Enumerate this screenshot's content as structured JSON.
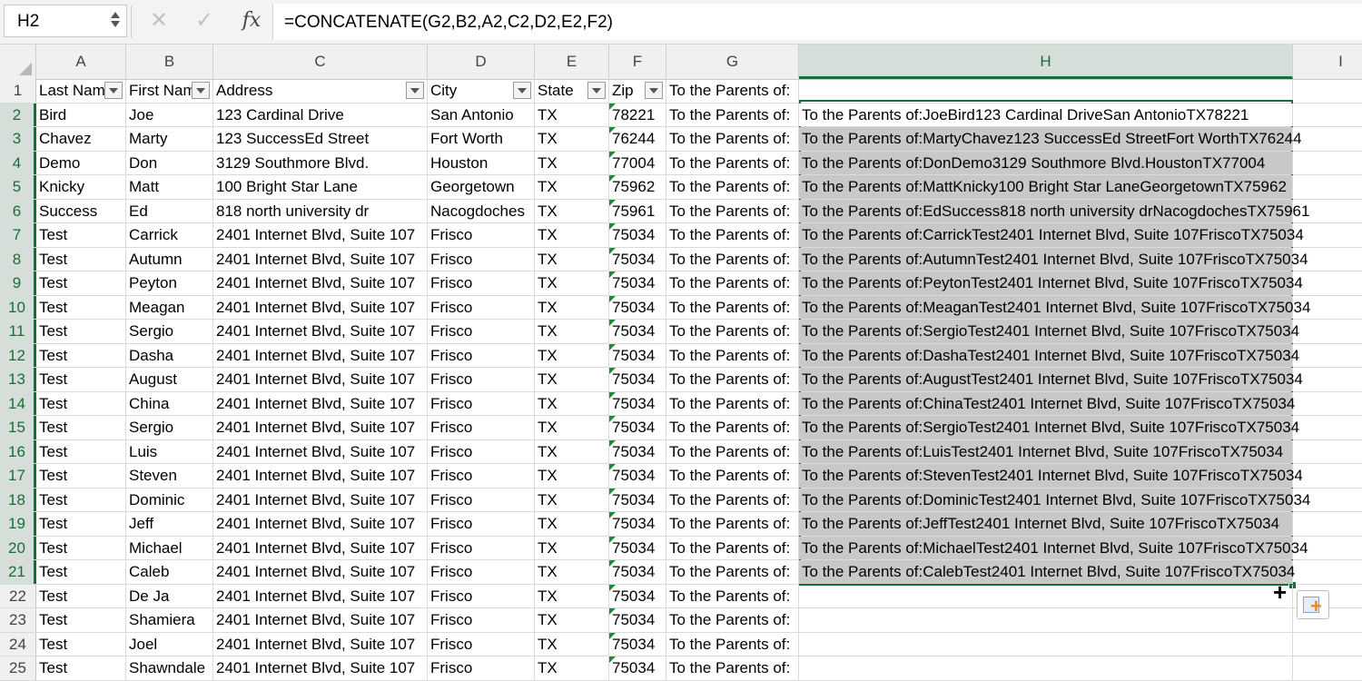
{
  "formula_bar": {
    "name_box": "H2",
    "cancel_icon": "✕",
    "enter_icon": "✓",
    "fx_label": "fx",
    "formula": "=CONCATENATE(G2,B2,A2,C2,D2,E2,F2)"
  },
  "columns": [
    "A",
    "B",
    "C",
    "D",
    "E",
    "F",
    "G",
    "H",
    "I"
  ],
  "header_row": {
    "A": "Last Nam",
    "B": "First Nam",
    "C": "Address",
    "D": "City",
    "E": "State",
    "F": "Zip",
    "G": "To the Parents of:",
    "H": ""
  },
  "rows": [
    {
      "n": "2",
      "A": "Bird",
      "B": "Joe",
      "C": "123 Cardinal Drive",
      "D": "San Antonio",
      "E": "TX",
      "F": "78221",
      "G": "To the Parents of:",
      "H": "To the Parents of:JoeBird123 Cardinal DriveSan AntonioTX78221"
    },
    {
      "n": "3",
      "A": "Chavez",
      "B": "Marty",
      "C": "123 SuccessEd Street",
      "D": "Fort Worth",
      "E": "TX",
      "F": "76244",
      "G": "To the Parents of:",
      "H": "To the Parents of:MartyChavez123 SuccessEd StreetFort WorthTX76244"
    },
    {
      "n": "4",
      "A": "Demo",
      "B": "Don",
      "C": "3129 Southmore Blvd.",
      "D": "Houston",
      "E": "TX",
      "F": "77004",
      "G": "To the Parents of:",
      "H": "To the Parents of:DonDemo3129 Southmore Blvd.HoustonTX77004"
    },
    {
      "n": "5",
      "A": "Knicky",
      "B": "Matt",
      "C": "100 Bright Star Lane",
      "D": "Georgetown",
      "E": "TX",
      "F": "75962",
      "G": "To the Parents of:",
      "H": "To the Parents of:MattKnicky100 Bright Star LaneGeorgetownTX75962"
    },
    {
      "n": "6",
      "A": "Success",
      "B": "Ed",
      "C": "818 north university dr",
      "D": "Nacogdoches",
      "E": "TX",
      "F": "75961",
      "G": "To the Parents of:",
      "H": "To the Parents of:EdSuccess818 north university drNacogdochesTX75961"
    },
    {
      "n": "7",
      "A": "Test",
      "B": "Carrick",
      "C": "2401 Internet Blvd, Suite 107",
      "D": "Frisco",
      "E": "TX",
      "F": "75034",
      "G": "To the Parents of:",
      "H": "To the Parents of:CarrickTest2401 Internet Blvd, Suite 107FriscoTX75034"
    },
    {
      "n": "8",
      "A": "Test",
      "B": "Autumn",
      "C": "2401 Internet Blvd, Suite 107",
      "D": "Frisco",
      "E": "TX",
      "F": "75034",
      "G": "To the Parents of:",
      "H": "To the Parents of:AutumnTest2401 Internet Blvd, Suite 107FriscoTX75034"
    },
    {
      "n": "9",
      "A": "Test",
      "B": "Peyton",
      "C": "2401 Internet Blvd, Suite 107",
      "D": "Frisco",
      "E": "TX",
      "F": "75034",
      "G": "To the Parents of:",
      "H": "To the Parents of:PeytonTest2401 Internet Blvd, Suite 107FriscoTX75034"
    },
    {
      "n": "10",
      "A": "Test",
      "B": "Meagan",
      "C": "2401 Internet Blvd, Suite 107",
      "D": "Frisco",
      "E": "TX",
      "F": "75034",
      "G": "To the Parents of:",
      "H": "To the Parents of:MeaganTest2401 Internet Blvd, Suite 107FriscoTX75034"
    },
    {
      "n": "11",
      "A": "Test",
      "B": "Sergio",
      "C": "2401 Internet Blvd, Suite 107",
      "D": "Frisco",
      "E": "TX",
      "F": "75034",
      "G": "To the Parents of:",
      "H": "To the Parents of:SergioTest2401 Internet Blvd, Suite 107FriscoTX75034"
    },
    {
      "n": "12",
      "A": "Test",
      "B": "Dasha",
      "C": "2401 Internet Blvd, Suite 107",
      "D": "Frisco",
      "E": "TX",
      "F": "75034",
      "G": "To the Parents of:",
      "H": "To the Parents of:DashaTest2401 Internet Blvd, Suite 107FriscoTX75034"
    },
    {
      "n": "13",
      "A": "Test",
      "B": "August",
      "C": "2401 Internet Blvd, Suite 107",
      "D": "Frisco",
      "E": "TX",
      "F": "75034",
      "G": "To the Parents of:",
      "H": "To the Parents of:AugustTest2401 Internet Blvd, Suite 107FriscoTX75034"
    },
    {
      "n": "14",
      "A": "Test",
      "B": "China",
      "C": "2401 Internet Blvd, Suite 107",
      "D": "Frisco",
      "E": "TX",
      "F": "75034",
      "G": "To the Parents of:",
      "H": "To the Parents of:ChinaTest2401 Internet Blvd, Suite 107FriscoTX75034"
    },
    {
      "n": "15",
      "A": "Test",
      "B": "Sergio",
      "C": "2401 Internet Blvd, Suite 107",
      "D": "Frisco",
      "E": "TX",
      "F": "75034",
      "G": "To the Parents of:",
      "H": "To the Parents of:SergioTest2401 Internet Blvd, Suite 107FriscoTX75034"
    },
    {
      "n": "16",
      "A": "Test",
      "B": "Luis",
      "C": "2401 Internet Blvd, Suite 107",
      "D": "Frisco",
      "E": "TX",
      "F": "75034",
      "G": "To the Parents of:",
      "H": "To the Parents of:LuisTest2401 Internet Blvd, Suite 107FriscoTX75034"
    },
    {
      "n": "17",
      "A": "Test",
      "B": "Steven",
      "C": "2401 Internet Blvd, Suite 107",
      "D": "Frisco",
      "E": "TX",
      "F": "75034",
      "G": "To the Parents of:",
      "H": "To the Parents of:StevenTest2401 Internet Blvd, Suite 107FriscoTX75034"
    },
    {
      "n": "18",
      "A": "Test",
      "B": "Dominic",
      "C": "2401 Internet Blvd, Suite 107",
      "D": "Frisco",
      "E": "TX",
      "F": "75034",
      "G": "To the Parents of:",
      "H": "To the Parents of:DominicTest2401 Internet Blvd, Suite 107FriscoTX75034"
    },
    {
      "n": "19",
      "A": "Test",
      "B": "Jeff",
      "C": "2401 Internet Blvd, Suite 107",
      "D": "Frisco",
      "E": "TX",
      "F": "75034",
      "G": "To the Parents of:",
      "H": "To the Parents of:JeffTest2401 Internet Blvd, Suite 107FriscoTX75034"
    },
    {
      "n": "20",
      "A": "Test",
      "B": "Michael",
      "C": "2401 Internet Blvd, Suite 107",
      "D": "Frisco",
      "E": "TX",
      "F": "75034",
      "G": "To the Parents of:",
      "H": "To the Parents of:MichaelTest2401 Internet Blvd, Suite 107FriscoTX75034"
    },
    {
      "n": "21",
      "A": "Test",
      "B": "Caleb",
      "C": "2401 Internet Blvd, Suite 107",
      "D": "Frisco",
      "E": "TX",
      "F": "75034",
      "G": "To the Parents of:",
      "H": "To the Parents of:CalebTest2401 Internet Blvd, Suite 107FriscoTX75034"
    },
    {
      "n": "22",
      "A": "Test",
      "B": "De Ja",
      "C": "2401 Internet Blvd, Suite 107",
      "D": "Frisco",
      "E": "TX",
      "F": "75034",
      "G": "To the Parents of:",
      "H": ""
    },
    {
      "n": "23",
      "A": "Test",
      "B": "Shamiera",
      "C": "2401 Internet Blvd, Suite 107",
      "D": "Frisco",
      "E": "TX",
      "F": "75034",
      "G": "To the Parents of:",
      "H": ""
    },
    {
      "n": "24",
      "A": "Test",
      "B": "Joel",
      "C": "2401 Internet Blvd, Suite 107",
      "D": "Frisco",
      "E": "TX",
      "F": "75034",
      "G": "To the Parents of:",
      "H": ""
    },
    {
      "n": "25",
      "A": "Test",
      "B": "Shawndale",
      "C": "2401 Internet Blvd, Suite 107",
      "D": "Frisco",
      "E": "TX",
      "F": "75034",
      "G": "To the Parents of:",
      "H": ""
    }
  ],
  "colors": {
    "selection_green": "#1e6b3a",
    "highlight_gray": "#c8c8c8",
    "error_triangle": "#1e8a3c"
  },
  "icons": {
    "autofill_options": "auto-fill-options-icon",
    "fill_cursor": "crosshair-cursor-icon"
  }
}
